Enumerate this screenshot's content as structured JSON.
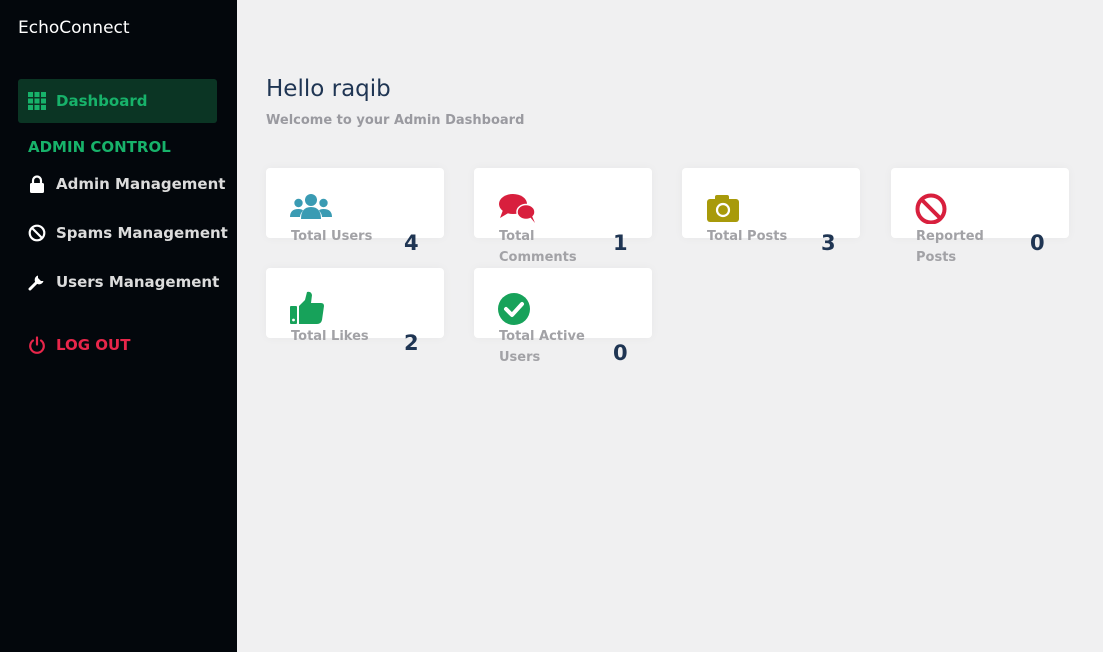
{
  "app": {
    "title": "EchoConnect"
  },
  "sidebar": {
    "dashboard_label": "Dashboard",
    "section_title": "ADMIN CONTROL",
    "items": [
      {
        "label": "Admin Management",
        "icon": "lock-icon"
      },
      {
        "label": "Spams Management",
        "icon": "ban-icon"
      },
      {
        "label": "Users Management",
        "icon": "wrench-icon"
      }
    ],
    "logout_label": "LOG OUT"
  },
  "header": {
    "greeting": "Hello raqib",
    "subtitle": "Welcome to your Admin Dashboard"
  },
  "stats": [
    {
      "label": "Total Users",
      "value": "4",
      "icon": "users-icon",
      "color": "#3a9bb3"
    },
    {
      "label": "Total Comments",
      "value": "1",
      "icon": "comments-icon",
      "color": "#d81f3d"
    },
    {
      "label": "Total Posts",
      "value": "3",
      "icon": "camera-icon",
      "color": "#a89a0a"
    },
    {
      "label": "Reported Posts",
      "value": "0",
      "icon": "ban-icon",
      "color": "#d81f3d"
    },
    {
      "label": "Total Likes",
      "value": "2",
      "icon": "thumbs-up-icon",
      "color": "#17a25a"
    },
    {
      "label": "Total Active Users",
      "value": "0",
      "icon": "check-circle-icon",
      "color": "#17a25a"
    }
  ],
  "colors": {
    "sidebar_bg": "#03070c",
    "accent_green": "#17b26a",
    "logout_red": "#e8264a",
    "heading": "#1f3553"
  }
}
